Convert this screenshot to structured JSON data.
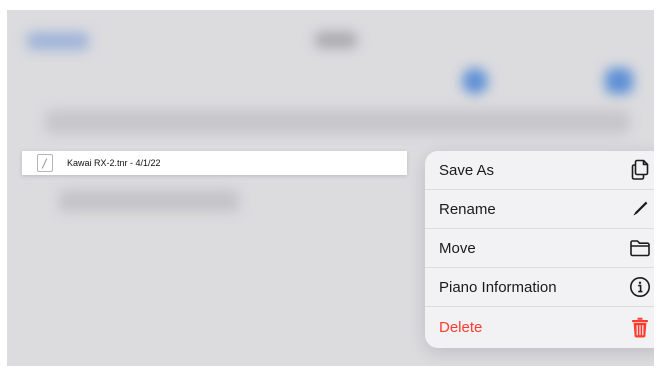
{
  "file_row": {
    "name": "Kawai RX-2.tnr - 4/1/22"
  },
  "menu": {
    "items": [
      {
        "label": "Save As",
        "icon": "copy-icon"
      },
      {
        "label": "Rename",
        "icon": "pencil-icon"
      },
      {
        "label": "Move",
        "icon": "folder-icon"
      },
      {
        "label": "Piano Information",
        "icon": "info-circle-icon"
      },
      {
        "label": "Delete",
        "icon": "trash-icon",
        "destructive": true
      }
    ]
  },
  "colors": {
    "overlay": "#dcdcdf",
    "menu_background": "#f2f2f4",
    "destructive": "#ff3b30",
    "accent_blurred": "#5d8fd6"
  }
}
